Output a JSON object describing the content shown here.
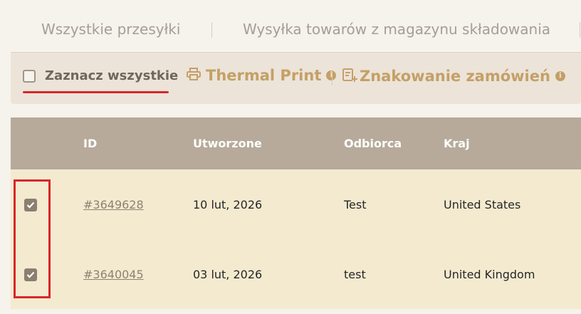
{
  "tabs": [
    {
      "label": "Wszystkie przesyłki"
    },
    {
      "label": "Wysyłka towarów z magazynu składowania"
    }
  ],
  "toolbar": {
    "select_all_label": "Zaznacz wszystkie",
    "thermal_print_label": "Thermal Print",
    "marking_label": "Znakowanie zamówień",
    "info_glyph": "i"
  },
  "table": {
    "columns": [
      "ID",
      "Utworzone",
      "Odbiorca",
      "Kraj"
    ],
    "rows": [
      {
        "checked": true,
        "id": "#3649628",
        "created": "10 lut, 2026",
        "recipient": "Test",
        "country": "United States"
      },
      {
        "checked": true,
        "id": "#3640045",
        "created": "03 lut, 2026",
        "recipient": "test",
        "country": "United Kingdom"
      }
    ]
  },
  "colors": {
    "accent": "#c4a067",
    "header_bg": "#b7aa9b",
    "row_bg": "#f4ead0",
    "highlight": "#d9262a"
  },
  "icons": {
    "thermal_print": "printer-icon",
    "marking": "label-add-icon",
    "info": "info-icon",
    "checkbox_checked": "check-icon"
  }
}
